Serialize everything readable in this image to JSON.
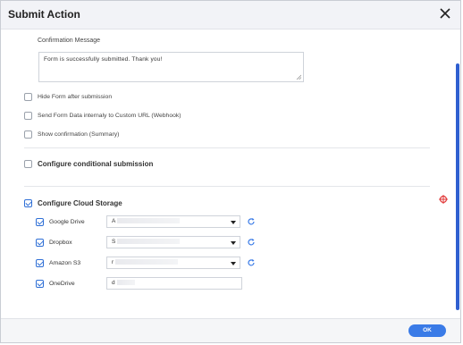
{
  "dialog": {
    "title": "Submit Action"
  },
  "confirmation": {
    "label": "Confirmation Message",
    "value": "Form is successfully submitted. Thank you!"
  },
  "options": [
    {
      "label": "Hide Form after submission",
      "checked": false
    },
    {
      "label": "Send Form Data internaly to Custom URL (Webhook)",
      "checked": false
    },
    {
      "label": "Show confirmation (Summary)",
      "checked": false
    }
  ],
  "sections": {
    "conditional": {
      "label": "Configure conditional submission",
      "checked": false
    },
    "cloud": {
      "label": "Configure Cloud Storage",
      "checked": true
    }
  },
  "cloud_services": [
    {
      "label": "Google Drive",
      "value": "A",
      "checked": true,
      "has_dropdown": true
    },
    {
      "label": "Dropbox",
      "value": "S",
      "checked": true,
      "has_dropdown": true
    },
    {
      "label": "Amazon S3",
      "value": "r",
      "checked": true,
      "has_dropdown": true
    },
    {
      "label": "OneDrive",
      "value": "d",
      "checked": true,
      "has_dropdown": false
    }
  ],
  "footer": {
    "ok_label": "OK"
  },
  "colors": {
    "accent": "#3a7be7",
    "scrollbar": "#2f5fd0",
    "target": "#e23b3b"
  }
}
